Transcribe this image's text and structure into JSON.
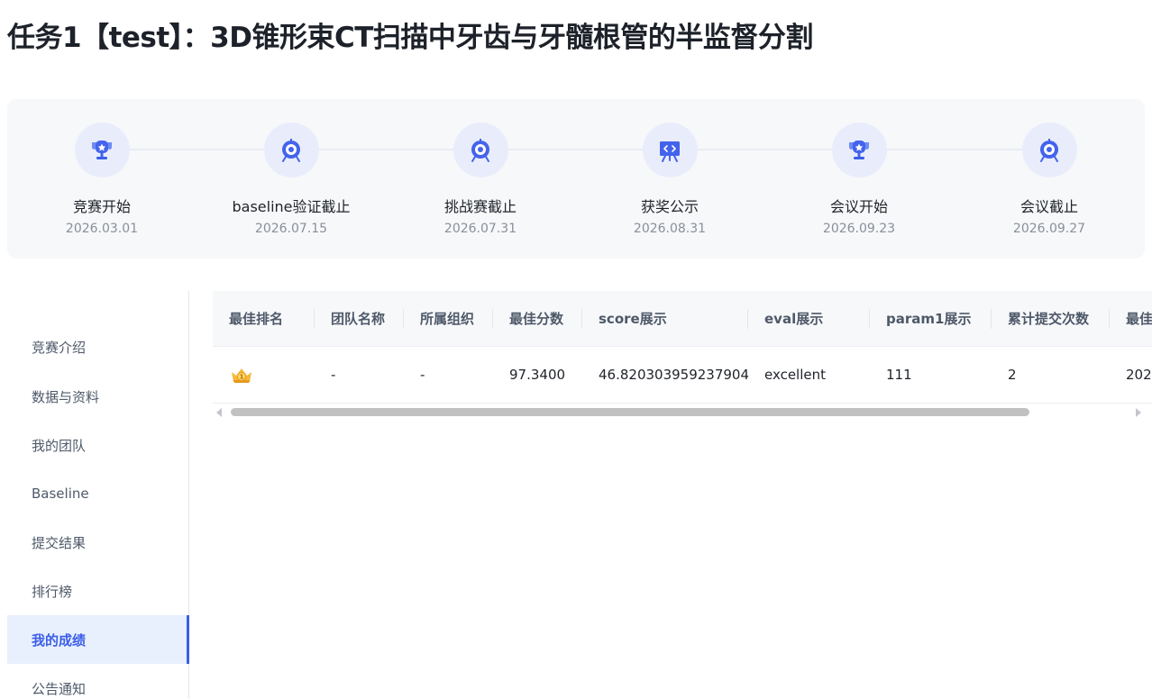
{
  "page": {
    "title": "任务1【test】：3D锥形束CT扫描中牙齿与牙髓根管的半监督分割"
  },
  "timeline": [
    {
      "label": "竞赛开始",
      "date": "2026.03.01",
      "icon": "trophy-icon"
    },
    {
      "label": "baseline验证截止",
      "date": "2026.07.15",
      "icon": "target-icon"
    },
    {
      "label": "挑战赛截止",
      "date": "2026.07.31",
      "icon": "target-icon"
    },
    {
      "label": "获奖公示",
      "date": "2026.08.31",
      "icon": "presentation-icon"
    },
    {
      "label": "会议开始",
      "date": "2026.09.23",
      "icon": "trophy-icon"
    },
    {
      "label": "会议截止",
      "date": "2026.09.27",
      "icon": "target-icon"
    }
  ],
  "sidebar": {
    "items": [
      {
        "label": "竞赛介绍"
      },
      {
        "label": "数据与资料"
      },
      {
        "label": "我的团队"
      },
      {
        "label": "Baseline"
      },
      {
        "label": "提交结果"
      },
      {
        "label": "排行榜"
      },
      {
        "label": "我的成绩"
      },
      {
        "label": "公告通知"
      }
    ],
    "active_label": "我的成绩"
  },
  "table": {
    "headers": [
      "最佳排名",
      "团队名称",
      "所属组织",
      "最佳分数",
      "score展示",
      "eval展示",
      "param1展示",
      "累计提交次数",
      "最佳"
    ],
    "rows": [
      {
        "rank_icon": "crown-medal-icon",
        "team": "-",
        "org": "-",
        "best_score": "97.3400",
        "score_show": "46.820303959237904",
        "eval_show": "excellent",
        "param1_show": "111",
        "submit_count": "2",
        "best_time": "202"
      }
    ]
  },
  "colors": {
    "accent": "#3b5ee8",
    "icon_circle_bg": "#e9edfb",
    "timeline_bg": "#f7f8fa",
    "active_item_bg": "#e8f0fe"
  }
}
